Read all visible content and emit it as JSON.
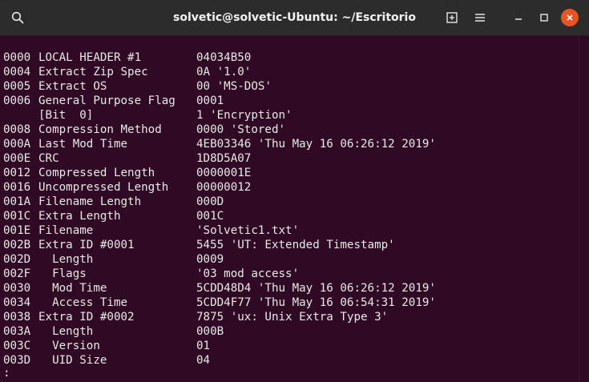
{
  "window": {
    "title": "solvetic@solvetic-Ubuntu: ~/Escritorio"
  },
  "terminal": {
    "lines": [
      {
        "offset": "0000",
        "label": "LOCAL HEADER #1",
        "value": "04034B50"
      },
      {
        "offset": "0004",
        "label": "Extract Zip Spec",
        "value": "0A '1.0'"
      },
      {
        "offset": "0005",
        "label": "Extract OS",
        "value": "00 'MS-DOS'"
      },
      {
        "offset": "0006",
        "label": "General Purpose Flag",
        "value": "0001"
      },
      {
        "offset": "",
        "label": "[Bit  0]",
        "value": "1 'Encryption'"
      },
      {
        "offset": "0008",
        "label": "Compression Method",
        "value": "0000 'Stored'"
      },
      {
        "offset": "000A",
        "label": "Last Mod Time",
        "value": "4EB03346 'Thu May 16 06:26:12 2019'"
      },
      {
        "offset": "000E",
        "label": "CRC",
        "value": "1D8D5A07"
      },
      {
        "offset": "0012",
        "label": "Compressed Length",
        "value": "0000001E"
      },
      {
        "offset": "0016",
        "label": "Uncompressed Length",
        "value": "00000012"
      },
      {
        "offset": "001A",
        "label": "Filename Length",
        "value": "000D"
      },
      {
        "offset": "001C",
        "label": "Extra Length",
        "value": "001C"
      },
      {
        "offset": "001E",
        "label": "Filename",
        "value": "'Solvetic1.txt'"
      },
      {
        "offset": "002B",
        "label": "Extra ID #0001",
        "value": "5455 'UT: Extended Timestamp'"
      },
      {
        "offset": "002D",
        "label": "  Length",
        "value": "0009"
      },
      {
        "offset": "002F",
        "label": "  Flags",
        "value": "'03 mod access'"
      },
      {
        "offset": "0030",
        "label": "  Mod Time",
        "value": "5CDD48D4 'Thu May 16 06:26:12 2019'"
      },
      {
        "offset": "0034",
        "label": "  Access Time",
        "value": "5CDD4F77 'Thu May 16 06:54:31 2019'"
      },
      {
        "offset": "0038",
        "label": "Extra ID #0002",
        "value": "7875 'ux: Unix Extra Type 3'"
      },
      {
        "offset": "003A",
        "label": "  Length",
        "value": "000B"
      },
      {
        "offset": "003C",
        "label": "  Version",
        "value": "01"
      },
      {
        "offset": "003D",
        "label": "  UID Size",
        "value": "04"
      }
    ],
    "prompt": ":"
  },
  "colors": {
    "terminal_bg": "#300a24",
    "titlebar_bg": "#2c2c2c",
    "close_button": "#e95420",
    "text": "#e8e8e8"
  },
  "icons": {
    "search": "search-icon",
    "new_tab": "new-tab-icon",
    "menu": "hamburger-menu-icon",
    "minimize": "minimize-icon",
    "maximize": "maximize-icon",
    "close": "close-icon"
  }
}
